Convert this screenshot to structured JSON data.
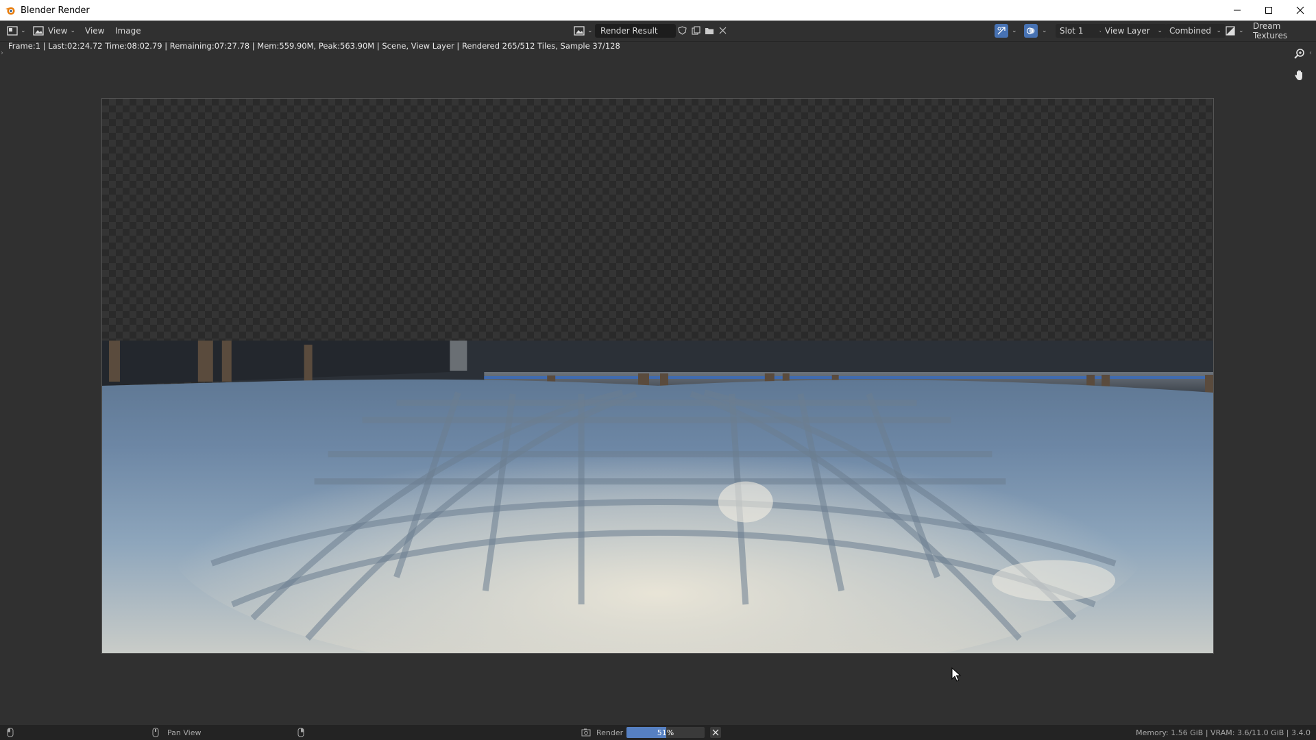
{
  "window": {
    "title": "Blender Render",
    "icons": [
      "blender-logo-icon",
      "minimize-icon",
      "maximize-icon",
      "close-icon"
    ]
  },
  "header": {
    "menus": [
      "View",
      "View",
      "Image"
    ],
    "image_name": "Render Result",
    "slot": "Slot 1",
    "view_layer": "View Layer",
    "pass": "Combined",
    "addon": "Dream Textures"
  },
  "info_line": "Frame:1 | Last:02:24.72 Time:08:02.79 | Remaining:07:27.78 | Mem:559.90M, Peak:563.90M | Scene, View Layer | Rendered 265/512 Tiles, Sample 37/128",
  "status_bar": {
    "pan_label": "Pan View",
    "render_label": "Render",
    "progress_percent": 51,
    "progress_text": "51%",
    "memory": "Memory: 1.56 GiB | VRAM: 3.6/11.0 GiB | 3.4.0"
  },
  "colors": {
    "accent": "#4772b3",
    "progress_fill": "#5680c2",
    "background": "#303030"
  }
}
